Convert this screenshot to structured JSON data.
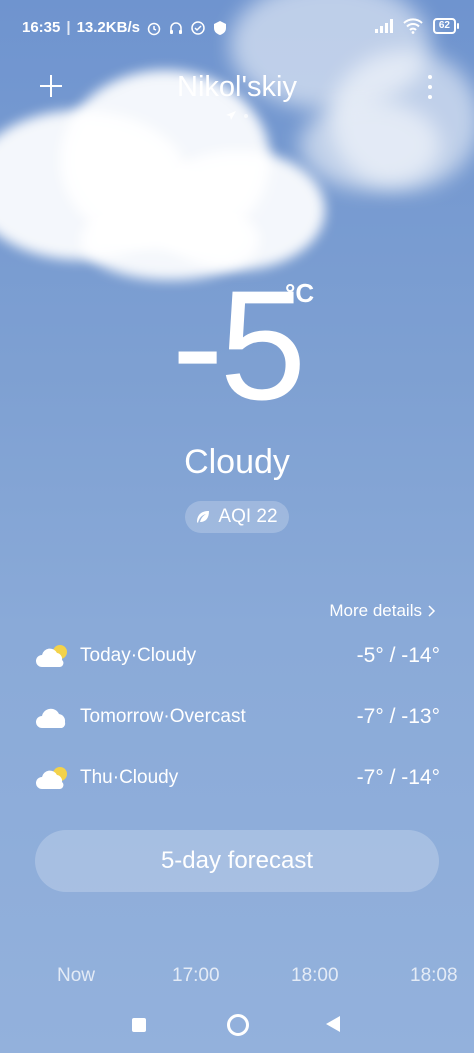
{
  "status_bar": {
    "time": "16:35",
    "net_speed": "13.2KB/s",
    "battery": "62"
  },
  "header": {
    "city": "Nikol'skiy",
    "icons": [
      "add-icon",
      "more-vert-icon",
      "location-arrow-icon"
    ]
  },
  "current": {
    "temperature": "-5",
    "unit": "°C",
    "condition": "Cloudy",
    "aqi_label": "AQI 22"
  },
  "daily": {
    "more_label": "More details",
    "rows": [
      {
        "label": "Today·Cloudy",
        "temps": "-5° / -14°",
        "icon": "partly-cloudy-icon"
      },
      {
        "label": "Tomorrow·Overcast",
        "temps": "-7° / -13°",
        "icon": "overcast-icon"
      },
      {
        "label": "Thu·Cloudy",
        "temps": "-7° / -14°",
        "icon": "partly-cloudy-icon"
      }
    ]
  },
  "forecast_button": "5-day forecast",
  "hourly": [
    "Now",
    "17:00",
    "18:00",
    "18:08"
  ],
  "colors": {
    "sky_top": "#6f94cf",
    "sky_bottom": "#93b1dc",
    "sun": "#f3d24a"
  }
}
